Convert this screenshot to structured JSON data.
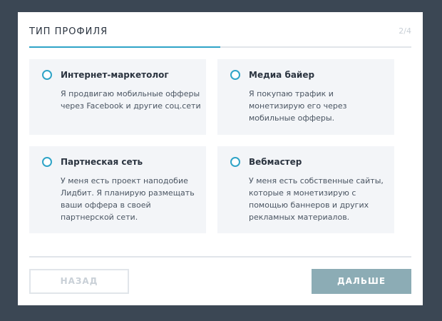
{
  "header": {
    "title": "ТИП ПРОФИЛЯ",
    "step": "2/4",
    "progress": 0.5
  },
  "options": [
    {
      "title": "Интернет-маркетолог",
      "desc": "Я продвигаю мобильные офферы через Facebook и другие соц.сети"
    },
    {
      "title": "Медиа байер",
      "desc": "Я покупаю трафик и монетизирую его через мобильные офферы."
    },
    {
      "title": "Партнеская сеть",
      "desc": "У меня есть проект наподобие Лидбит. Я планирую размещать ваши оффера в своей партнерской сети."
    },
    {
      "title": "Вебмастер",
      "desc": "У меня есть собственные сайты, которые я монетизирую с помощью баннеров и других рекламных материалов."
    }
  ],
  "footer": {
    "back_label": "НАЗАД",
    "next_label": "ДАЛЬШЕ"
  },
  "colors": {
    "accent": "#2fa4c7",
    "next_button": "#8cacb5"
  }
}
